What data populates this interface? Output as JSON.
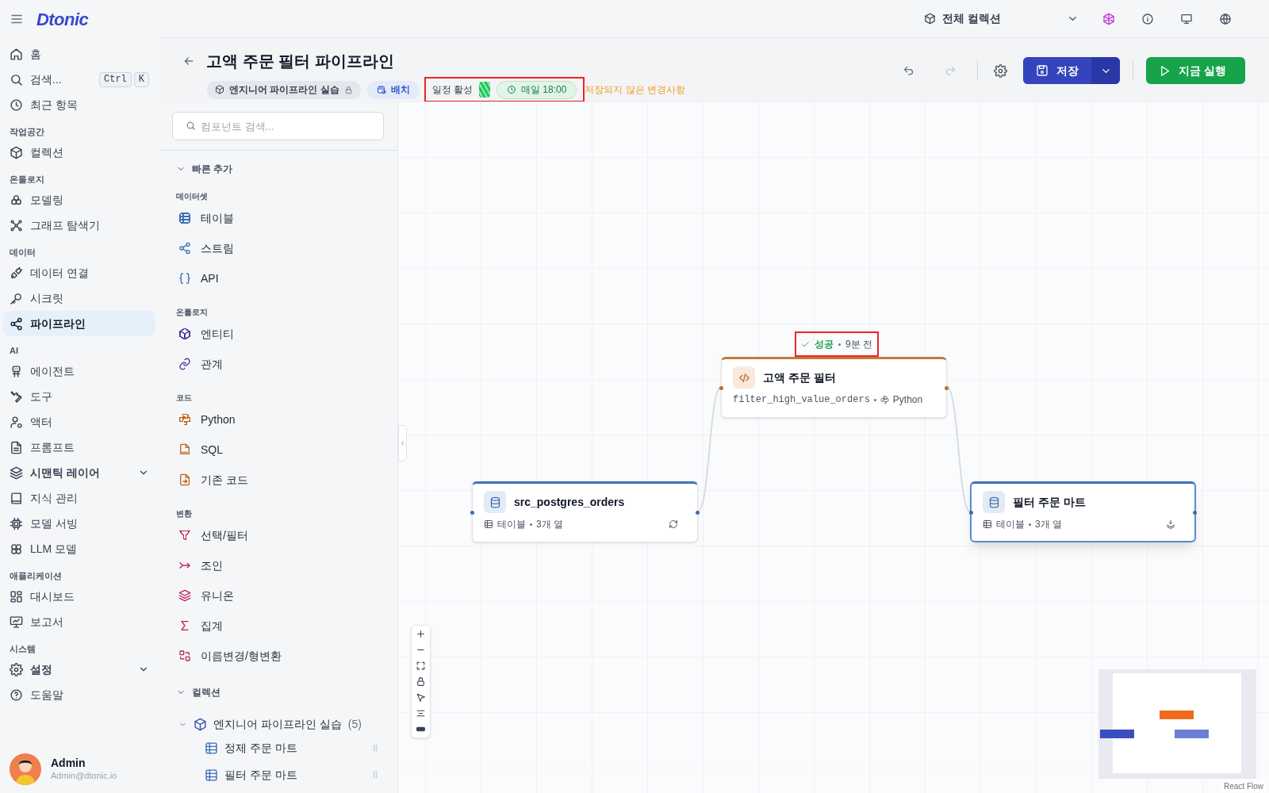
{
  "top_bar": {
    "logo": "Dtonic",
    "collection_selector": "전체 컬렉션"
  },
  "sidebar": {
    "sections": [
      {
        "items": [
          {
            "label": "홈",
            "kind": "link",
            "selected": false
          },
          {
            "label": "검색...",
            "kind": "link",
            "selected": false,
            "shortcut": [
              "Ctrl",
              "K"
            ]
          },
          {
            "label": "최근 항목",
            "kind": "link",
            "selected": false
          }
        ]
      },
      {
        "title": "작업공간",
        "items": [
          {
            "label": "컬렉션",
            "kind": "link",
            "selected": false
          }
        ]
      },
      {
        "title": "온톨로지",
        "items": [
          {
            "label": "모델링",
            "kind": "link",
            "selected": false
          },
          {
            "label": "그래프 탐색기",
            "kind": "link",
            "selected": false
          }
        ]
      },
      {
        "title": "데이터",
        "items": [
          {
            "label": "데이터 연결",
            "kind": "link",
            "selected": false
          },
          {
            "label": "시크릿",
            "kind": "link",
            "selected": false
          },
          {
            "label": "파이프라인",
            "kind": "link",
            "selected": true
          }
        ]
      },
      {
        "title": "AI",
        "items": [
          {
            "label": "에이전트",
            "kind": "link",
            "selected": false
          },
          {
            "label": "도구",
            "kind": "link",
            "selected": false
          },
          {
            "label": "액터",
            "kind": "link",
            "selected": false
          },
          {
            "label": "프롬프트",
            "kind": "link",
            "selected": false
          },
          {
            "label": "시맨틱 레이어",
            "kind": "group",
            "selected": false
          },
          {
            "label": "지식 관리",
            "kind": "link",
            "selected": false
          },
          {
            "label": "모델 서빙",
            "kind": "link",
            "selected": false
          },
          {
            "label": "LLM 모델",
            "kind": "link",
            "selected": false
          }
        ]
      },
      {
        "title": "애플리케이션",
        "items": [
          {
            "label": "대시보드",
            "kind": "link",
            "selected": false
          },
          {
            "label": "보고서",
            "kind": "link",
            "selected": false
          }
        ]
      },
      {
        "title": "시스템",
        "items": [
          {
            "label": "설정",
            "kind": "group",
            "selected": false
          },
          {
            "label": "도움말",
            "kind": "link",
            "selected": false
          }
        ]
      }
    ],
    "user": {
      "name": "Admin",
      "email": "Admin@dtonic.io"
    }
  },
  "header": {
    "title": "고액 주문 필터 파이프라인",
    "collection_chip": "엔지니어 파이프라인 실습",
    "mode_chip": "배치",
    "schedule": {
      "label": "일정 활성",
      "on": true,
      "time": "매일 18:00",
      "highlighted": true
    },
    "unsaved": "저장되지 않은 변경사항"
  },
  "toolbar": {
    "save": "저장",
    "run": "지금 실행"
  },
  "components": {
    "search_placeholder": "컴포넌트 검색...",
    "quick_add": {
      "title": "빠른 추가",
      "expanded": true,
      "categories": [
        {
          "title": "데이터셋",
          "color": "#3b6fb6",
          "items": [
            "테이블",
            "스트림",
            "API"
          ]
        },
        {
          "title": "온톨로지",
          "color": "#4a3a9a",
          "items": [
            "엔티티",
            "관계"
          ]
        },
        {
          "title": "코드",
          "color": "#c0651a",
          "items": [
            "Python",
            "SQL",
            "기존 코드"
          ]
        },
        {
          "title": "변환",
          "color": "#c0245c",
          "items": [
            "선택/필터",
            "조인",
            "유니온",
            "집계",
            "이름변경/형변환"
          ]
        }
      ]
    },
    "collections": {
      "title": "컬렉션",
      "expanded": true,
      "children": [
        {
          "label": "엔지니어 파이프라인 실습",
          "count": "(5)",
          "expanded": true,
          "children": [
            {
              "label": "정제 주문 마트"
            },
            {
              "label": "필터 주문 마트"
            }
          ]
        }
      ]
    }
  },
  "canvas": {
    "nodes": [
      {
        "kind": "dataset",
        "title": "src_postgres_orders",
        "type": "테이블",
        "columns": "3개 열",
        "selected": false
      },
      {
        "kind": "code",
        "title": "고액 주문 필터",
        "function": "filter_high_value_orders",
        "language": "Python",
        "selected": false,
        "status": {
          "label": "성공",
          "time": "9분 전",
          "highlighted": true
        }
      },
      {
        "kind": "dataset",
        "title": "필터 주문 마트",
        "type": "테이블",
        "columns": "3개 열",
        "selected": true
      }
    ],
    "attribution": "React Flow"
  }
}
